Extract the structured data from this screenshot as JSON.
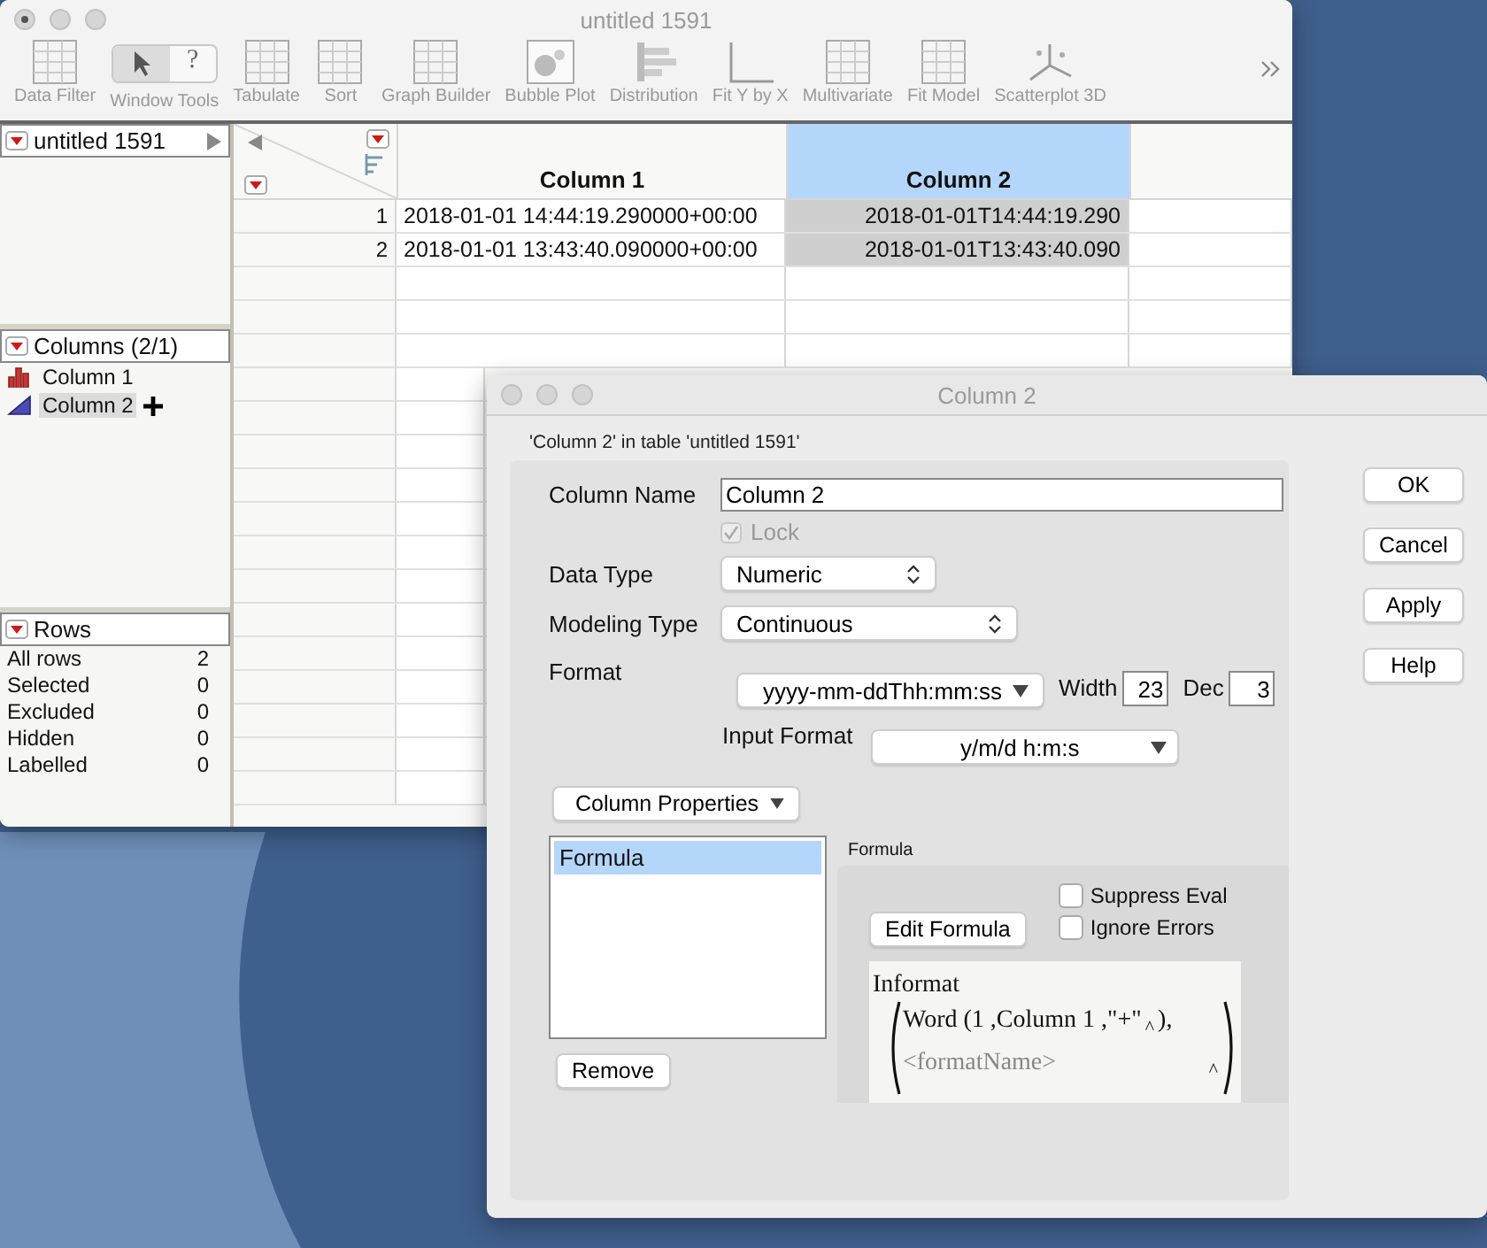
{
  "main_window": {
    "title": "untitled 1591",
    "toolbar": [
      {
        "label": "Data Filter",
        "kind": "filter"
      },
      {
        "label": "Window Tools",
        "kind": "tools"
      },
      {
        "label": "Tabulate",
        "kind": "table"
      },
      {
        "label": "Sort",
        "kind": "sort"
      },
      {
        "label": "Graph Builder",
        "kind": "grid"
      },
      {
        "label": "Bubble Plot",
        "kind": "bubble"
      },
      {
        "label": "Distribution",
        "kind": "bars"
      },
      {
        "label": "Fit Y by X",
        "kind": "fit"
      },
      {
        "label": "Multivariate",
        "kind": "grid"
      },
      {
        "label": "Fit Model",
        "kind": "model"
      },
      {
        "label": "Scatterplot 3D",
        "kind": "scatter"
      }
    ],
    "help_glyph": "?",
    "table_panel": {
      "title": "untitled 1591"
    },
    "columns_panel": {
      "title": "Columns (2/1)",
      "items": [
        {
          "name": "Column 1",
          "kind": "nominal",
          "selected": false
        },
        {
          "name": "Column 2",
          "kind": "continuous",
          "selected": true
        }
      ]
    },
    "rows_panel": {
      "title": "Rows",
      "items": [
        {
          "label": "All rows",
          "count": "2"
        },
        {
          "label": "Selected",
          "count": "0"
        },
        {
          "label": "Excluded",
          "count": "0"
        },
        {
          "label": "Hidden",
          "count": "0"
        },
        {
          "label": "Labelled",
          "count": "0"
        }
      ]
    },
    "grid": {
      "columns": [
        {
          "name": "Column 1",
          "selected": false
        },
        {
          "name": "Column 2",
          "selected": true
        }
      ],
      "rows": [
        {
          "number": "1",
          "cells": [
            "2018-01-01 14:44:19.290000+00:00",
            "2018-01-01T14:44:19.290"
          ]
        },
        {
          "number": "2",
          "cells": [
            "2018-01-01 13:43:40.090000+00:00",
            "2018-01-01T13:43:40.090"
          ]
        }
      ]
    }
  },
  "dialog": {
    "title": "Column 2",
    "caption": "'Column 2' in table 'untitled 1591'",
    "column_name": {
      "label": "Column Name",
      "value": "Column 2"
    },
    "lock": {
      "label": "Lock",
      "checked": true,
      "disabled": true
    },
    "data_type": {
      "label": "Data Type",
      "value": "Numeric"
    },
    "modeling_type": {
      "label": "Modeling Type",
      "value": "Continuous"
    },
    "format": {
      "label": "Format",
      "value": "yyyy-mm-ddThh:mm:ss"
    },
    "width": {
      "label": "Width",
      "value": "23"
    },
    "dec": {
      "label": "Dec",
      "value": "3"
    },
    "input_format": {
      "label": "Input Format",
      "value": "y/m/d h:m:s"
    },
    "column_properties": "Column Properties",
    "properties": [
      {
        "label": "Formula",
        "selected": true
      }
    ],
    "remove": "Remove",
    "formula_section": {
      "title": "Formula",
      "edit_button": "Edit Formula",
      "options": [
        {
          "label": "Suppress Eval",
          "checked": false
        },
        {
          "label": "Ignore Errors",
          "checked": false
        }
      ],
      "formula": {
        "function": "Informat",
        "first_arg": "Word (1 ,Column 1 ,\"+\"",
        "insert_mark": "^",
        "close": "),",
        "second_arg": "<formatName>"
      }
    },
    "buttons": [
      "OK",
      "Cancel",
      "Apply",
      "Help"
    ]
  }
}
